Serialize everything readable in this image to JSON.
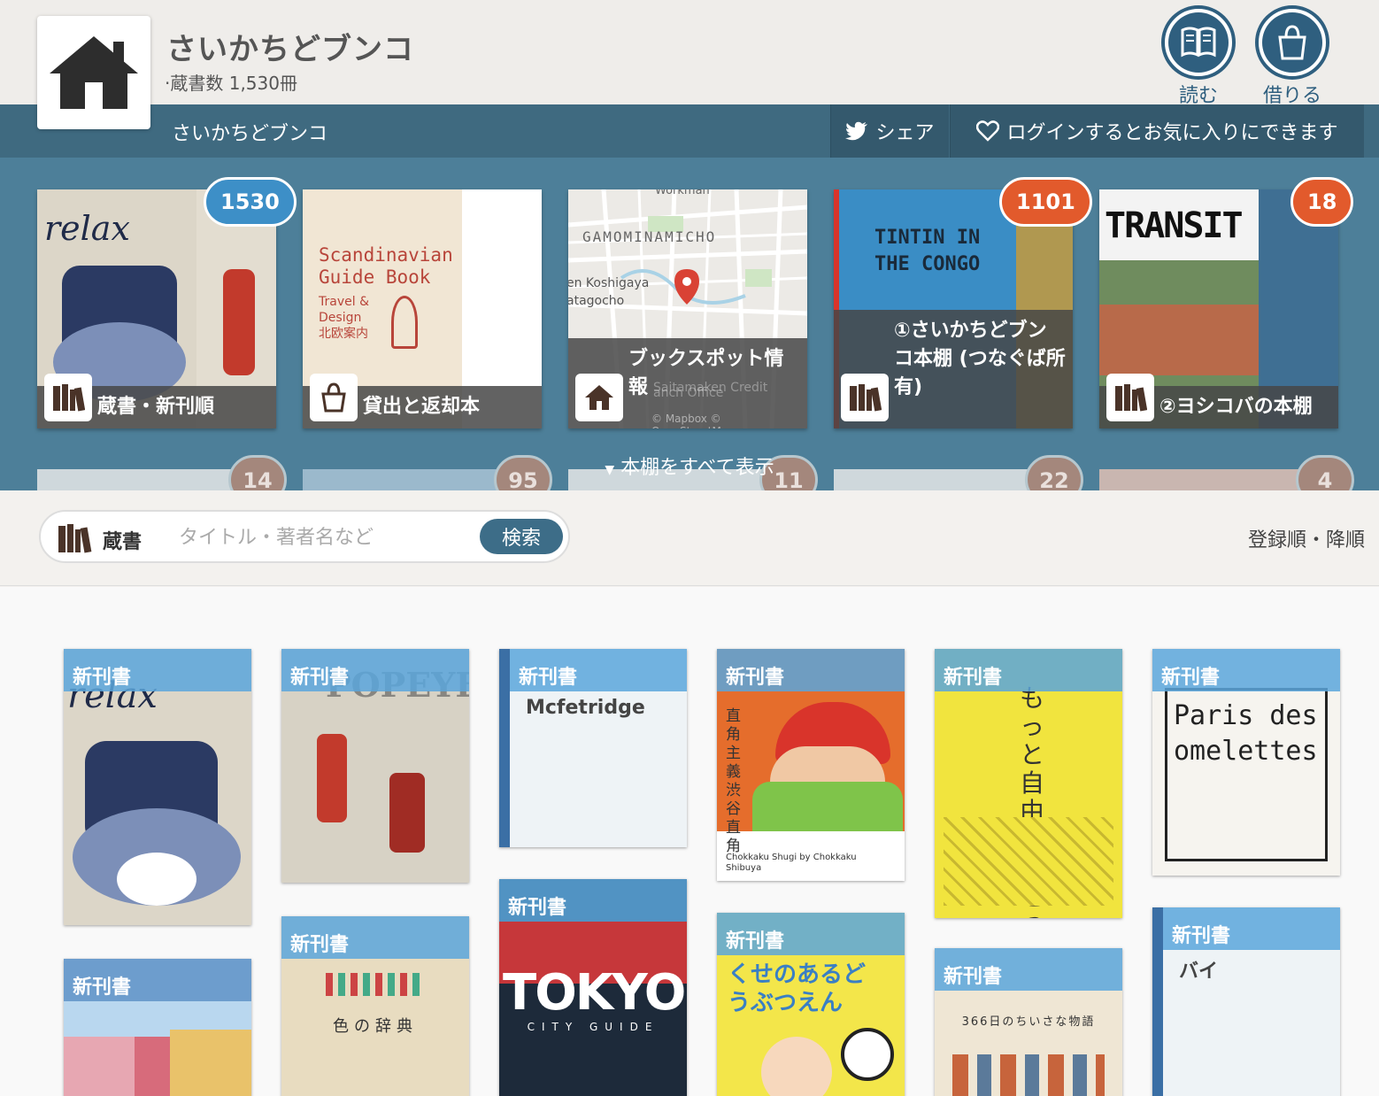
{
  "header": {
    "title": "さいかちどブンコ",
    "count": "·蔵書数 1,530冊",
    "read_label": "読む",
    "borrow_label": "借りる"
  },
  "nav": {
    "name": "さいかちどブンコ",
    "share": "シェア",
    "favorite": "ログインするとお気に入りにできます"
  },
  "shelves": [
    {
      "caption": "蔵書・新刊順",
      "badge": "1530",
      "badge_color": "#3d8fc7"
    },
    {
      "caption": "貸出と返却本",
      "badge": null
    },
    {
      "caption": "ブックスポット情報",
      "badge": null,
      "map_labels": [
        "Workman",
        "GAMOMINAMICHO",
        "en Koshigaya",
        "atagocho",
        "Saitamaken Credit",
        "anch Office",
        "© Mapbox © OpenStreetMap"
      ]
    },
    {
      "caption": "①さいかちどブンコ本棚 (つなぐば所有)",
      "badge": "1101",
      "badge_color": "#e25a2c"
    },
    {
      "caption": "②ヨシコバの本棚",
      "badge": "18",
      "badge_color": "#e25a2c"
    }
  ],
  "shelves_row2_badges": [
    "14",
    "95",
    "11",
    "22",
    "4"
  ],
  "show_all": "本棚をすべて表示",
  "search": {
    "scope": "蔵書",
    "placeholder": "タイトル・著者名など",
    "button": "検索"
  },
  "sort": "登録順・降順",
  "new_label": "新刊書",
  "books": [
    {
      "kind": "cover",
      "cover_text": "relax"
    },
    {
      "kind": "cover",
      "cover_text": "POPEYE"
    },
    {
      "kind": "text",
      "title": "Mcfetridge"
    },
    {
      "kind": "cover",
      "cover_text": "直角主義 渋谷直角",
      "subtitle": "Chokkaku Shugi by Chokkaku Shibuya"
    },
    {
      "kind": "cover",
      "cover_text": "もっと自由に家をつくろう"
    },
    {
      "kind": "cover",
      "cover_text": "Paris des omelettes"
    },
    {
      "kind": "cover",
      "cover_text": "TOKYO",
      "subtitle": "CITY GUIDE"
    },
    {
      "kind": "cover",
      "cover_text": "色の辞典"
    },
    {
      "kind": "cover",
      "cover_text": "くせのあるどうぶつえん"
    },
    {
      "kind": "cover",
      "cover_text": "366日のちいさな物語"
    },
    {
      "kind": "text",
      "title": "バイ"
    },
    {
      "kind": "cover",
      "cover_text": ""
    }
  ],
  "colors": {
    "nav": "#3f6a80",
    "shelf_bg": "#4d7f99",
    "accent": "#3d6d88",
    "new_badge": "#5aa6dc"
  }
}
